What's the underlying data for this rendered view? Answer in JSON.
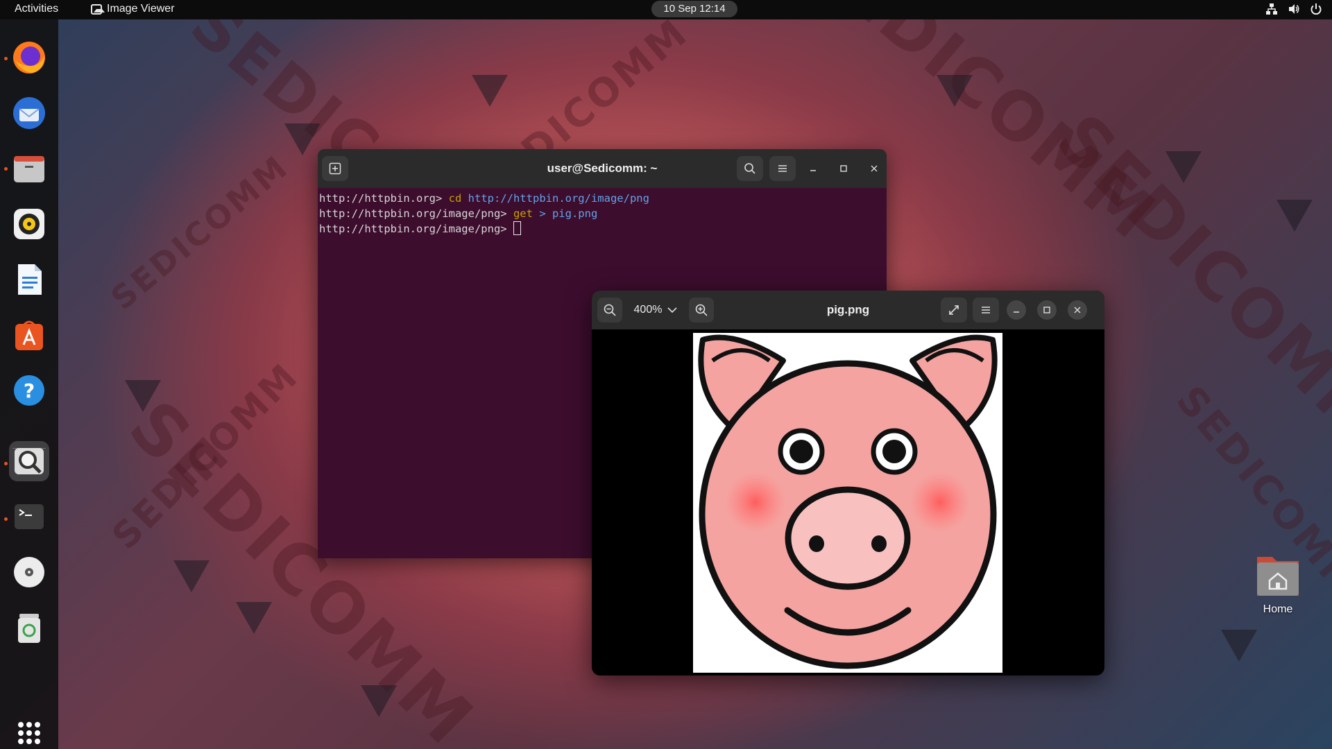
{
  "topbar": {
    "activities": "Activities",
    "app_name": "Image Viewer",
    "clock": "10 Sep  12:14"
  },
  "dock": {
    "items": [
      "firefox-icon",
      "thunderbird-icon",
      "files-icon",
      "rhythmbox-icon",
      "writer-icon",
      "app-center-icon",
      "help-icon",
      "image-viewer-icon",
      "terminal-icon",
      "disc-icon",
      "trash-icon",
      "show-apps-icon"
    ]
  },
  "terminal": {
    "title": "user@Sedicomm: ~",
    "lines": [
      {
        "prompt": "http://httpbin.org>",
        "cmd": "cd",
        "arg": "http://httpbin.org/image/png"
      },
      {
        "prompt": "http://httpbin.org/image/png>",
        "cmd": "get",
        "arg": "> pig.png"
      },
      {
        "prompt": "http://httpbin.org/image/png>",
        "cmd": "",
        "arg": ""
      }
    ]
  },
  "viewer": {
    "title": "pig.png",
    "zoom": "400%"
  },
  "desktop": {
    "home_label": "Home",
    "watermark": "SEDICOMM"
  },
  "colors": {
    "terminal_bg": "#3d0d2e",
    "header_bg": "#2b2b2b",
    "accent": "#e95420",
    "pig_pink": "#f5a3a0"
  }
}
